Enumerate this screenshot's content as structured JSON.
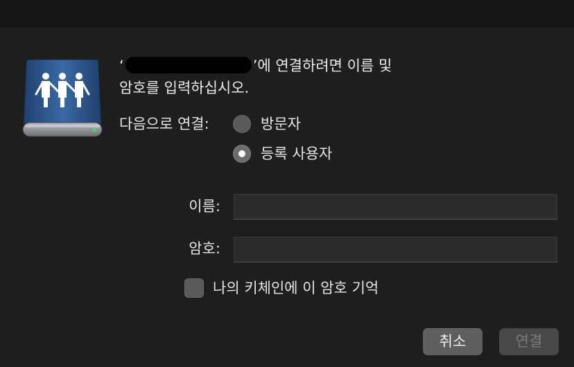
{
  "dialog": {
    "message": {
      "open_quote": "‘",
      "after_server": "’에 연결하려면 이름 및",
      "line2": "암호를 입력하십시오."
    },
    "connect_as": {
      "label": "다음으로 연결:",
      "options": [
        {
          "label": "방문자",
          "selected": false
        },
        {
          "label": "등록 사용자",
          "selected": true
        }
      ]
    },
    "name_field": {
      "label": "이름:",
      "value": "",
      "placeholder": ""
    },
    "password_field": {
      "label": "암호:",
      "value": "",
      "placeholder": ""
    },
    "remember": {
      "label": "나의 키체인에 이 암호 기억",
      "checked": false
    },
    "buttons": {
      "cancel": "취소",
      "connect": "연결"
    }
  },
  "icons": {
    "server": "network-server-drive-icon"
  },
  "colors": {
    "background": "#1e1e1e",
    "titlebar": "#161616",
    "field_bg": "#2c2c2c",
    "cancel_button": "#5e5e5e",
    "connect_button_disabled": "#484848",
    "drive_blue": "#2e5a94"
  }
}
